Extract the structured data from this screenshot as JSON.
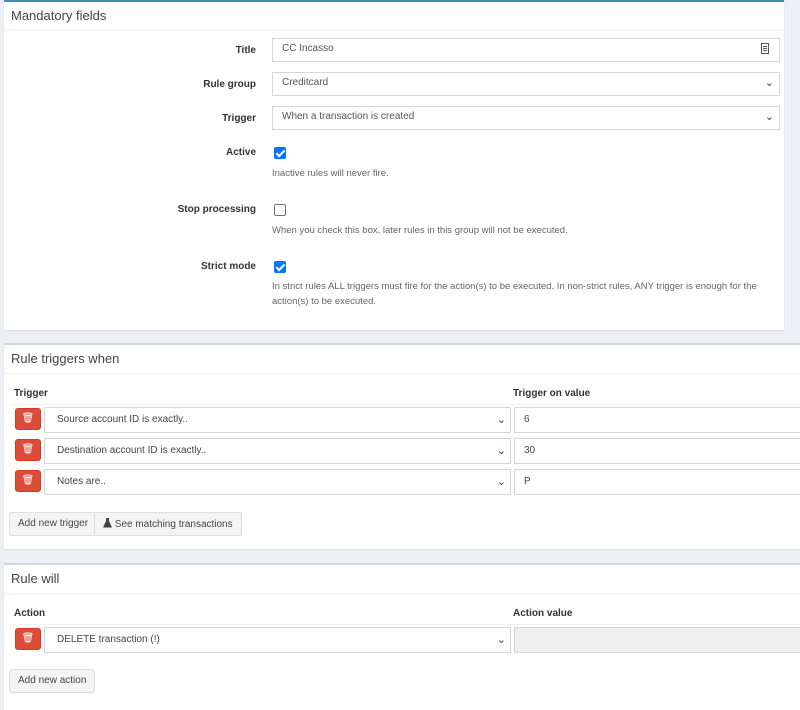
{
  "mandatory": {
    "header": "Mandatory fields",
    "title_label": "Title",
    "title_value": "CC Incasso",
    "rule_group_label": "Rule group",
    "rule_group_value": "Creditcard",
    "trigger_label": "Trigger",
    "trigger_value": "When a transaction is created",
    "active_label": "Active",
    "active_checked": true,
    "active_help": "Inactive rules will never fire.",
    "stop_label": "Stop processing",
    "stop_checked": false,
    "stop_help": "When you check this box, later rules in this group will not be executed.",
    "strict_label": "Strict mode",
    "strict_checked": true,
    "strict_help": "In strict rules ALL triggers must fire for the action(s) to be executed. In non-strict rules, ANY trigger is enough for the action(s) to be executed."
  },
  "triggers": {
    "header": "Rule triggers when",
    "col_trigger": "Trigger",
    "col_value": "Trigger on value",
    "rows": [
      {
        "trigger": "Source account ID is exactly..",
        "value": "6"
      },
      {
        "trigger": "Destination account ID is exactly..",
        "value": "30"
      },
      {
        "trigger": "Notes are..",
        "value": "P"
      }
    ],
    "add_button": "Add new trigger",
    "see_matching_button": "See matching transactions"
  },
  "actions": {
    "header": "Rule will",
    "col_action": "Action",
    "col_value": "Action value",
    "rows": [
      {
        "action": "DELETE transaction (!)",
        "value": ""
      }
    ],
    "add_button": "Add new action"
  },
  "colors": {
    "danger": "#dd4b39",
    "checkbox": "#0075ff",
    "background": "#ecf0f5"
  }
}
